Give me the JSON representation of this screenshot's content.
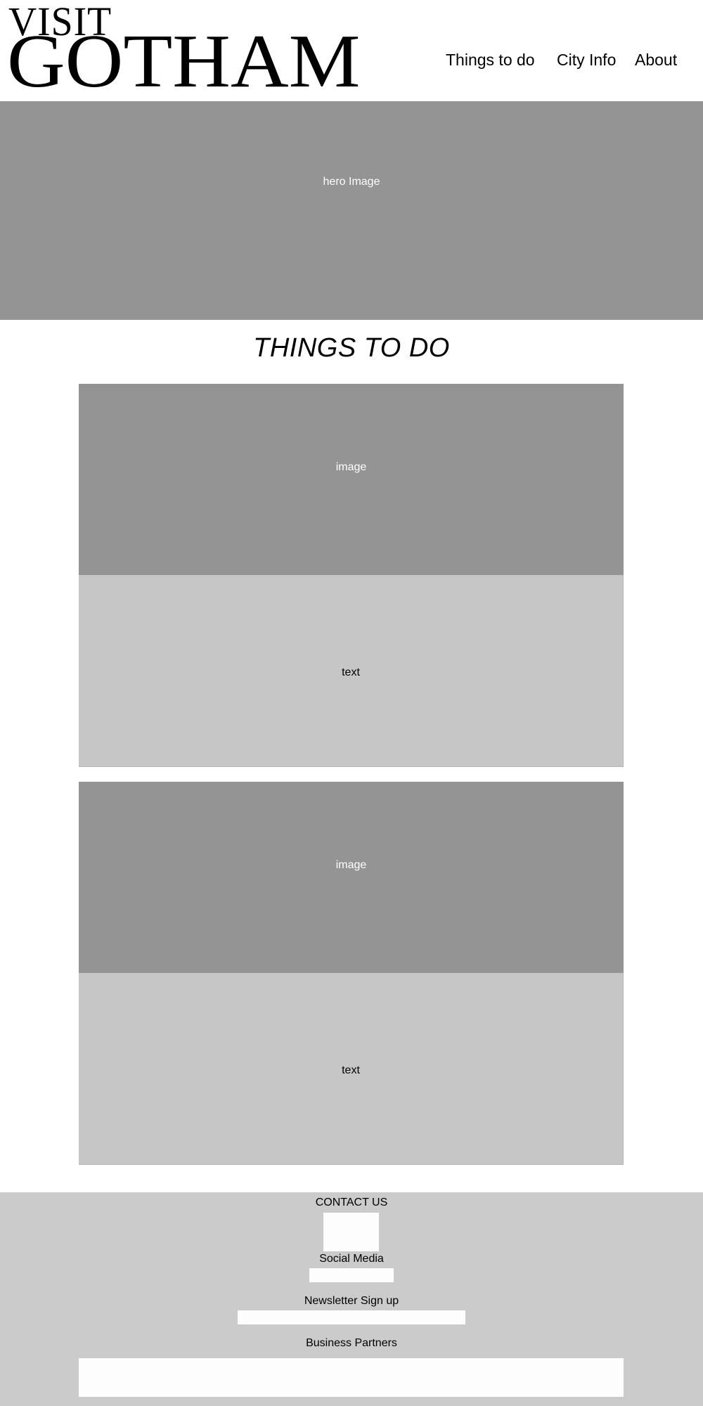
{
  "header": {
    "logo_line1": "VISIT",
    "logo_line2": "GOTHAM",
    "nav": {
      "things": "Things to do",
      "city": "City Info",
      "about": "About"
    }
  },
  "hero": {
    "label": "hero Image"
  },
  "section": {
    "title": "THINGS TO DO"
  },
  "cards": [
    {
      "image_label": "image",
      "text_label": "text"
    },
    {
      "image_label": "image",
      "text_label": "text"
    }
  ],
  "footer": {
    "contact_heading": "CONTACT US",
    "social_heading": "Social Media",
    "newsletter_heading": "Newsletter Sign up",
    "newsletter_placeholder": "",
    "partners_heading": "Business Partners"
  },
  "colors": {
    "placeholder_dark": "#949494",
    "placeholder_light": "#c6c6c6",
    "footer_bg": "#cbcbcb",
    "box_bg": "#fdfdfd"
  }
}
